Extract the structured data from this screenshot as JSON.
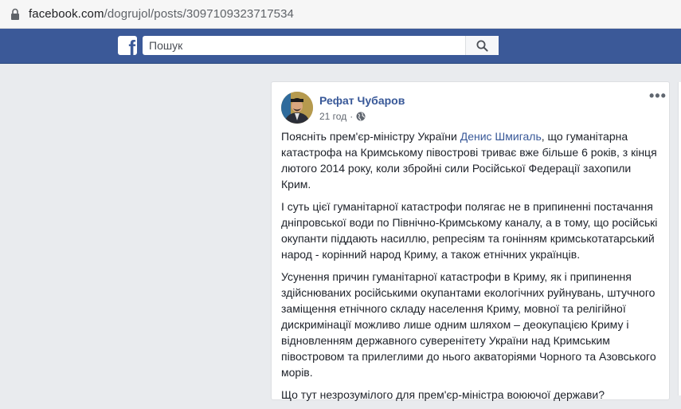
{
  "browser": {
    "url_host": "facebook.com",
    "url_path": "/dogrujol/posts/3097109323717534"
  },
  "topbar": {
    "logo": "f",
    "search_placeholder": "Пошук"
  },
  "post": {
    "author": "Рефат Чубаров",
    "time": "21 год",
    "privacy_icon": "globe-icon",
    "more_label": "•••",
    "p1_before": "Поясніть прем'єр-міністру України ",
    "p1_mention": "Денис Шмигаль",
    "p1_after": ", що гуманітарна катастрофа на Кримському півострові триває вже більше 6 років, з кінця лютого 2014 року, коли збройні сили Російської Федерації захопили Крим.",
    "p2": "І суть цієї гуманітарної катастрофи полягає не в припиненні постачання дніпровської води по Північно-Кримському каналу, а в тому, що російські окупанти піддають насиллю, репресіям та гонінням кримськотатарський народ - корінний народ Криму, а також етнічних українців.",
    "p3": "Усунення причин гуманітарної катастрофи в Криму, як і припинення здійснюваних російськими окупантами екологічних руйнувань, штучного заміщення етнічного складу населення Криму, мовної та релігійної дискримінації можливо лише одним шляхом – деокупацією Криму і відновленням державного суверенітету України над Кримським півостровом та прилеглими до нього акваторіями Чорного та Азовського морів.",
    "p4": "Що тут незрозумілого для прем'єр-міністра воюючої держави?"
  },
  "colors": {
    "facebook_blue": "#3b5998",
    "link": "#385898",
    "background": "#e9ebee"
  }
}
